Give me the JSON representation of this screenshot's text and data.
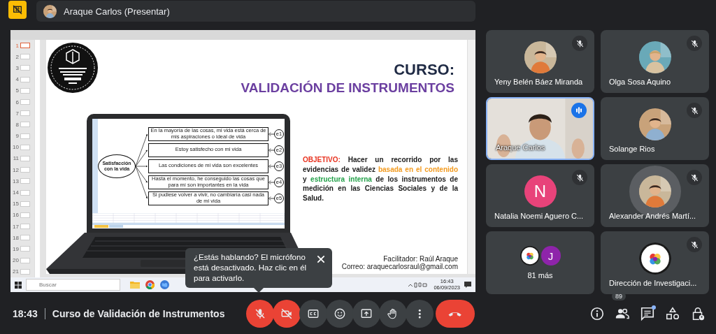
{
  "presenter_bar": {
    "label": "Araque Carlos (Presentar)"
  },
  "shared_screen": {
    "slides": [
      {
        "number": "1",
        "selected": true
      },
      {
        "number": "2",
        "selected": false
      },
      {
        "number": "3",
        "selected": false
      },
      {
        "number": "4",
        "selected": false
      },
      {
        "number": "5",
        "selected": false
      },
      {
        "number": "6",
        "selected": false
      },
      {
        "number": "7",
        "selected": false
      },
      {
        "number": "8",
        "selected": false
      },
      {
        "number": "9",
        "selected": false
      },
      {
        "number": "10",
        "selected": false
      },
      {
        "number": "11",
        "selected": false
      },
      {
        "number": "12",
        "selected": false
      },
      {
        "number": "13",
        "selected": false
      },
      {
        "number": "14",
        "selected": false
      },
      {
        "number": "15",
        "selected": false
      },
      {
        "number": "16",
        "selected": false
      },
      {
        "number": "17",
        "selected": false
      },
      {
        "number": "18",
        "selected": false
      },
      {
        "number": "19",
        "selected": false
      },
      {
        "number": "20",
        "selected": false
      },
      {
        "number": "21",
        "selected": false
      }
    ],
    "slide": {
      "title": "CURSO:",
      "subtitle": "VALIDACIÓN DE INSTRUMENTOS",
      "diagram": {
        "factor": "Satisfacción con la vida",
        "items": [
          {
            "text": "En la mayoría de las cosas, mi vida está cerca de mis aspiraciones o ideal de vida",
            "error": "e1"
          },
          {
            "text": "Estoy satisfecho con mi vida",
            "error": "e2"
          },
          {
            "text": "Las condiciones de mi vida son excelentes",
            "error": "e3"
          },
          {
            "text": "Hasta el momento, he conseguido las cosas que para mí son importantes en la vida",
            "error": "e4"
          },
          {
            "text": "Si pudiese volver a vivir, no cambiaría casi nada de mi vida",
            "error": "e5"
          }
        ]
      },
      "objective": [
        {
          "text": "OBJETIVO:",
          "color": "#e8321f"
        },
        {
          "text": " Hacer un recorrido por las evidencias de validez ",
          "color": "#1a1a1a"
        },
        {
          "text": "basada en el contenido",
          "color": "#f39a1d"
        },
        {
          "text": " y ",
          "color": "#1a1a1a"
        },
        {
          "text": "estructura interna",
          "color": "#22a048"
        },
        {
          "text": " de los instrumentos de medición en las Ciencias Sociales y de la Salud.",
          "color": "#1a1a1a"
        }
      ],
      "facilitator": "Facilitador: Raúl Araque",
      "email": "Correo: araquecarlosraul@gmail.com"
    },
    "taskbar": {
      "search_placeholder": "Buscar",
      "time": "16:43",
      "date": "06/09/2023"
    }
  },
  "participants": [
    {
      "name": "Yeny Belén Báez Miranda",
      "muted": true,
      "speaking": false
    },
    {
      "name": "Olga Sosa Aquino",
      "muted": true,
      "speaking": false
    },
    {
      "name": "Araque Carlos",
      "kind": "video",
      "muted": false,
      "speaking": true
    },
    {
      "name": "Solange Rios",
      "muted": true,
      "speaking": false
    },
    {
      "name": "Natalia Noemi Aguero C...",
      "kind": "initial",
      "initial": "N",
      "color": "#e8437a",
      "muted": true,
      "speaking": false
    },
    {
      "name": "Alexander Andrés Martí...",
      "muted": true,
      "speaking": true
    },
    {
      "name": "81 más",
      "kind": "more",
      "muted": false,
      "speaking": false,
      "avatars": [
        {
          "kind": "picture"
        },
        {
          "kind": "initial",
          "initial": "J",
          "color": "#8e24aa"
        }
      ]
    },
    {
      "name": "Dirección de Investigaci...",
      "muted": true,
      "speaking": false
    }
  ],
  "tooltip": {
    "text": "¿Estás hablando? El micrófono está desactivado. Haz clic en él para activarlo."
  },
  "meeting": {
    "time": "18:43",
    "title": "Curso de Validación de Instrumentos"
  },
  "controls": [
    {
      "kind": "mic",
      "on": false
    },
    {
      "kind": "camera",
      "on": false
    },
    {
      "kind": "captions",
      "on": false
    },
    {
      "kind": "emoji"
    },
    {
      "kind": "present"
    },
    {
      "kind": "hand"
    },
    {
      "kind": "more"
    },
    {
      "kind": "leave"
    }
  ],
  "side_controls": [
    {
      "kind": "info"
    },
    {
      "kind": "people",
      "badge": "89"
    },
    {
      "kind": "chat",
      "unread": true
    },
    {
      "kind": "activities"
    },
    {
      "kind": "lock"
    }
  ]
}
